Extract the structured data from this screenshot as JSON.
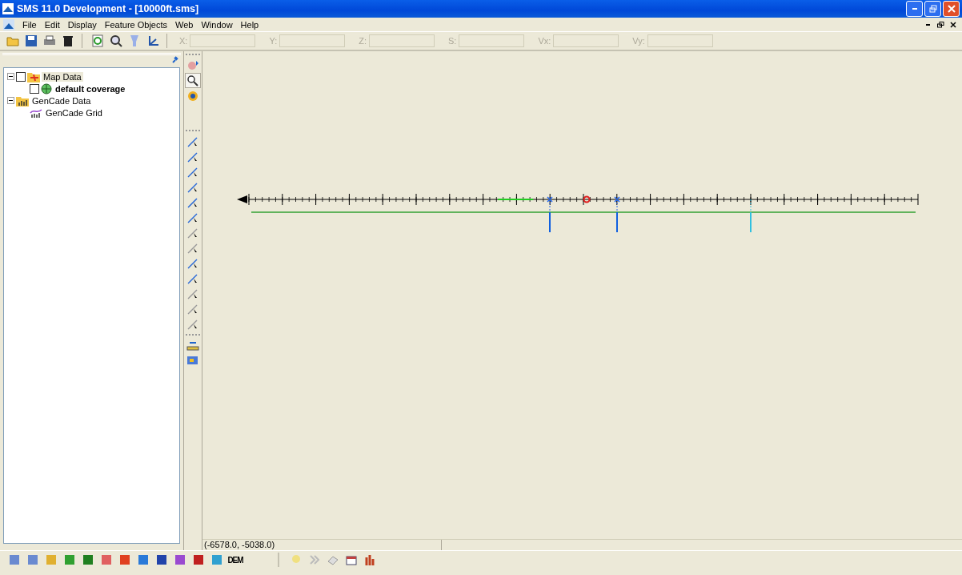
{
  "window": {
    "title": "SMS 11.0 Development - [10000ft.sms]"
  },
  "menu": [
    "File",
    "Edit",
    "Display",
    "Feature Objects",
    "Web",
    "Window",
    "Help"
  ],
  "coord_fields": [
    {
      "label": "X:",
      "disabled": true
    },
    {
      "label": "Y:",
      "disabled": true
    },
    {
      "label": "Z:",
      "disabled": true
    },
    {
      "label": "S:",
      "disabled": true
    },
    {
      "label": "Vx:",
      "disabled": true
    },
    {
      "label": "Vy:",
      "disabled": true
    }
  ],
  "tree": [
    {
      "label": "Map Data",
      "kind": "map",
      "checked": false,
      "selected": true,
      "active": false,
      "children": [
        {
          "label": "default coverage",
          "kind": "coverage",
          "checked": false,
          "selected": false,
          "active": true
        }
      ]
    },
    {
      "label": "GenCade Data",
      "kind": "folder",
      "selected": false,
      "active": false,
      "children": [
        {
          "label": "GenCade Grid",
          "kind": "grid",
          "selected": false,
          "active": false
        }
      ]
    }
  ],
  "status_bar": {
    "coordinates": "(-6578.0, -5038.0)"
  },
  "bottom_toolbar": {
    "dem_label": "DEM"
  }
}
